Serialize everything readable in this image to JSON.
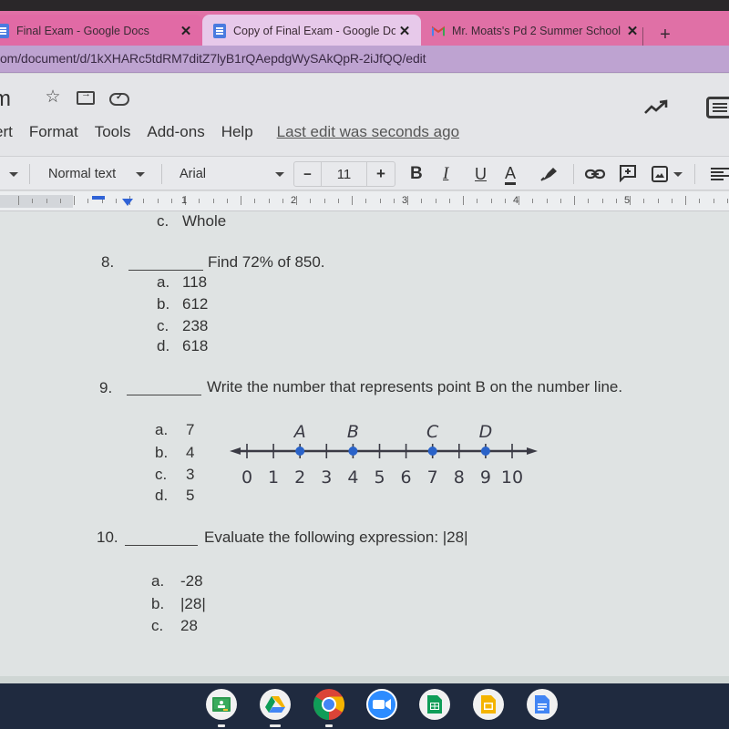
{
  "browser": {
    "tabs": [
      {
        "label": "Final Exam - Google Docs",
        "icon": "google-docs-icon",
        "active": false
      },
      {
        "label": "Copy of Final Exam - Google Docs",
        "icon": "google-docs-icon",
        "active": true
      },
      {
        "label": "Mr. Moats's Pd 2 Summer School",
        "icon": "gmail-icon",
        "active": false
      }
    ],
    "close_glyph": "✕",
    "new_tab_glyph": "+",
    "url": "om/document/d/1kXHARc5tdRM7ditZ7lyB1rQAepdgWySAkQpR-2iJfQQ/edit",
    "colors": {
      "tabstrip": "#e070a6",
      "active_tab": "#e7c9ea",
      "address_bar": "#bea3d1"
    }
  },
  "docs": {
    "title_fragment": "m",
    "title_icons": [
      "star-icon",
      "move-to-folder-icon",
      "cloud-saved-icon"
    ],
    "star_glyph": "☆",
    "menu": [
      "ert",
      "Format",
      "Tools",
      "Add-ons",
      "Help"
    ],
    "last_edit": "Last edit was seconds ago",
    "toolbar": {
      "style": "Normal text",
      "font": "Arial",
      "font_size": "11",
      "minus": "−",
      "plus": "+",
      "bold": "B",
      "italic": "I",
      "underline": "U",
      "text_color": "A"
    },
    "ruler_numbers": [
      "1",
      "2",
      "3",
      "4",
      "5"
    ]
  },
  "document": {
    "prev_option": {
      "letter": "c.",
      "text": "Whole"
    },
    "questions": [
      {
        "number": "8.",
        "prompt": "Find 72% of 850.",
        "options": [
          {
            "letter": "a.",
            "text": "118"
          },
          {
            "letter": "b.",
            "text": "612"
          },
          {
            "letter": "c.",
            "text": "238"
          },
          {
            "letter": "d.",
            "text": "618"
          }
        ]
      },
      {
        "number": "9.",
        "prompt": "Write the number that represents point B on the number line.",
        "options": [
          {
            "letter": "a.",
            "text": "7"
          },
          {
            "letter": "b.",
            "text": "4"
          },
          {
            "letter": "c.",
            "text": "3"
          },
          {
            "letter": "d.",
            "text": "5"
          }
        ]
      },
      {
        "number": "10.",
        "prompt": "Evaluate the following expression:  |28|",
        "options": [
          {
            "letter": "a.",
            "text": "-28"
          },
          {
            "letter": "b.",
            "text": "|28|"
          },
          {
            "letter": "c.",
            "text": "28"
          }
        ]
      }
    ],
    "number_line": {
      "min": 0,
      "max": 10,
      "ticks": [
        "0",
        "1",
        "2",
        "3",
        "4",
        "5",
        "6",
        "7",
        "8",
        "9",
        "10"
      ],
      "points": [
        {
          "label": "A",
          "value": 2
        },
        {
          "label": "B",
          "value": 4
        },
        {
          "label": "C",
          "value": 7
        },
        {
          "label": "D",
          "value": 9
        }
      ],
      "point_color": "#2a63c9"
    }
  },
  "shelf": {
    "apps": [
      {
        "name": "Google Classroom",
        "icon": "classroom-icon",
        "running": true
      },
      {
        "name": "Google Drive",
        "icon": "drive-icon",
        "running": true
      },
      {
        "name": "Chrome",
        "icon": "chrome-icon",
        "running": true
      },
      {
        "name": "Zoom",
        "icon": "zoom-icon",
        "running": false
      },
      {
        "name": "Google Sheets",
        "icon": "sheets-icon",
        "running": false
      },
      {
        "name": "Google Slides",
        "icon": "slides-icon",
        "running": false
      },
      {
        "name": "Google Docs",
        "icon": "docs-icon",
        "running": false
      }
    ]
  }
}
